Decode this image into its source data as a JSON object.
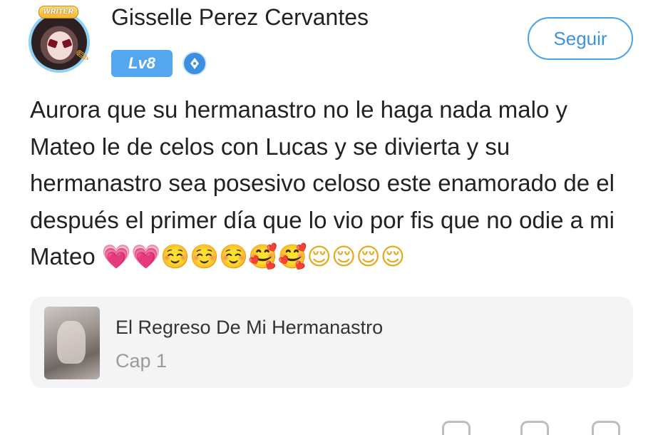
{
  "author": {
    "name": "Gisselle Perez Cervantes",
    "writer_badge": "WRITER",
    "level": "Lv8",
    "role_icon": "pen-nib-icon"
  },
  "follow_button": {
    "label": "Seguir"
  },
  "comment": {
    "text": "Aurora que su hermanastro no le haga nada malo y Mateo le de celos con Lucas y se divierta y su hermanastro sea posesivo celoso este enamorado de el después el primer día que lo vio por fis que no odie a mi Mateo",
    "emojis": [
      "💗",
      "💗",
      "☺️",
      "☺️",
      "☺️",
      "🥰",
      "🥰",
      "😌",
      "😌",
      "😌",
      "😌"
    ]
  },
  "story_card": {
    "title": "El Regreso De Mi Hermanastro",
    "chapter": "Cap 1"
  },
  "colors": {
    "accent": "#4aa3e8",
    "level_badge": "#54a7ee",
    "card_bg": "#f4f4f4",
    "muted_text": "#9a9a9a"
  }
}
